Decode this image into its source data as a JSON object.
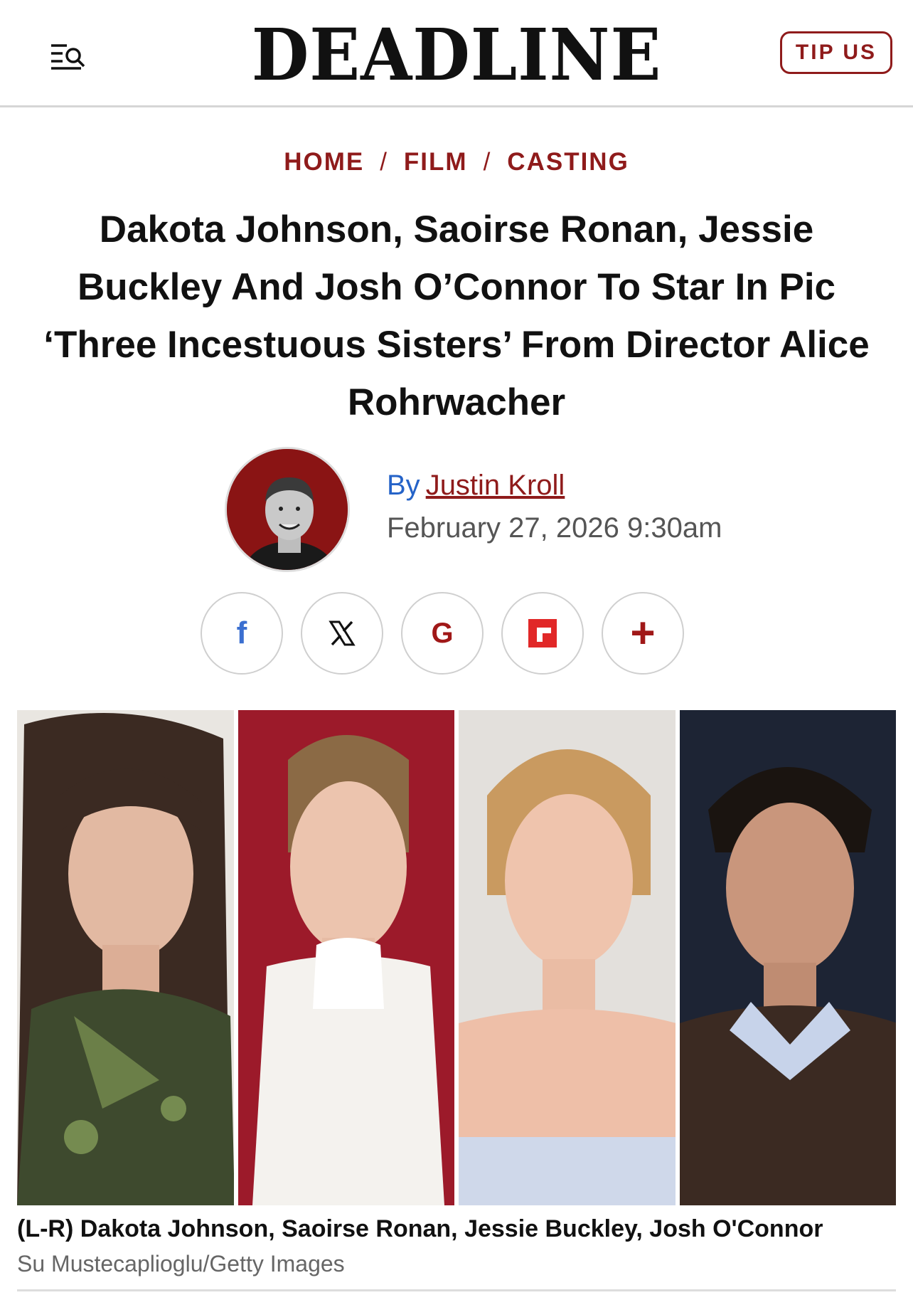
{
  "header": {
    "logo": "DEADLINE",
    "menu_icon": "menu-search-icon",
    "tip_label": "TIP US",
    "accent": "#8f1b1b"
  },
  "breadcrumb": {
    "items": [
      "HOME",
      "FILM",
      "CASTING"
    ],
    "separator": "/"
  },
  "article": {
    "headline": "Dakota Johnson, Saoirse Ronan, Jessie Buckley And Josh O’Connor To Star In Pic ‘Three Incestuous Sisters’ From Director Alice Rohrwacher",
    "by_label": "By",
    "author": "Justin Kroll",
    "date": "February 27, 2026 9:30am"
  },
  "share": {
    "buttons": [
      {
        "icon": "facebook-icon",
        "glyph": "f",
        "color": "#3b6fd0"
      },
      {
        "icon": "x-icon",
        "glyph": "𝕏",
        "color": "#111111"
      },
      {
        "icon": "google-icon",
        "glyph": "G",
        "color": "#a01818"
      },
      {
        "icon": "flipboard-icon",
        "glyph": "",
        "color": "#e12828"
      },
      {
        "icon": "plus-icon",
        "glyph": "+",
        "color": "#a01818"
      }
    ]
  },
  "photo": {
    "caption": "(L-R) Dakota Johnson, Saoirse Ronan, Jessie Buckley, Josh O'Connor",
    "credit": "Su Mustecaplioglu/Getty Images"
  }
}
